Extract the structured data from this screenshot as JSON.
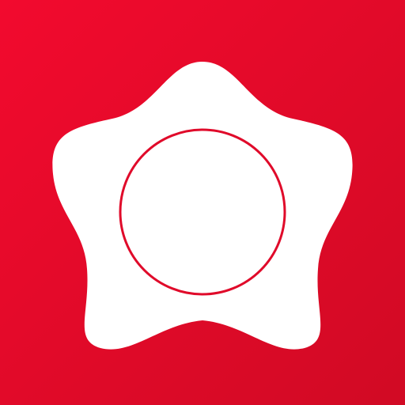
{
  "app_icon": {
    "background_color_start": "#f20a2e",
    "background_color_end": "#d10a24",
    "shape_color": "#ffffff",
    "ring_color": "#e00a2a",
    "shape_icon": "rounded-star-icon",
    "ring_icon": "circle-outline-icon"
  }
}
